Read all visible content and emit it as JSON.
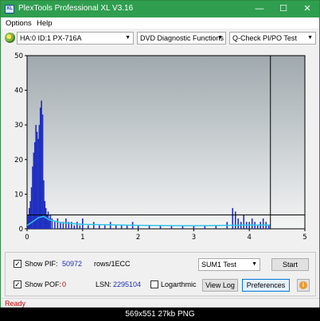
{
  "window": {
    "title": "PlexTools Professional XL V3.16",
    "icon_label": "XL",
    "minimize": "—",
    "maximize": "☐",
    "close": "✕"
  },
  "menu": {
    "items": [
      "Options",
      "Help"
    ]
  },
  "toolbar": {
    "drive": "HA:0 ID:1  PX-716A",
    "function": "DVD Diagnostic Functions",
    "test": "Q-Check PI/PO Test"
  },
  "chart_data": {
    "type": "bar",
    "x_ticks": [
      "0",
      "1",
      "2",
      "3",
      "4",
      "5"
    ],
    "y_ticks": [
      "0",
      "10",
      "20",
      "30",
      "40",
      "50"
    ],
    "xlim": [
      0,
      5
    ],
    "ylim": [
      0,
      50
    ],
    "threshold_value": 4,
    "end_marker_x": 4.38,
    "colors": {
      "pi_bars": "#1f2fc0",
      "pi_avg": "#2ec4e8",
      "threshold": "#000000",
      "end_marker": "#000000"
    },
    "series": [
      {
        "values_x": [
          0.02,
          0.04,
          0.06,
          0.08,
          0.1,
          0.12,
          0.14,
          0.16,
          0.18,
          0.2,
          0.22,
          0.24,
          0.26,
          0.28,
          0.3,
          0.32,
          0.34,
          0.36,
          0.38,
          0.4,
          0.42,
          0.45,
          0.5,
          0.55,
          0.6,
          0.65,
          0.7,
          0.75,
          0.8,
          0.85,
          0.9,
          0.95,
          1.0,
          1.1,
          1.2,
          1.3,
          1.4,
          1.5,
          1.6,
          1.7,
          1.8,
          1.9,
          2.0,
          2.2,
          2.4,
          2.6,
          2.8,
          3.0,
          3.2,
          3.4,
          3.6,
          3.7,
          3.75,
          3.8,
          3.85,
          3.9,
          3.95,
          4.0,
          4.05,
          4.1,
          4.15,
          4.2,
          4.25,
          4.3,
          4.35
        ],
        "values_y": [
          4,
          6,
          8,
          12,
          18,
          22,
          25,
          30,
          28,
          26,
          30,
          35,
          37,
          33,
          14,
          8,
          6,
          4,
          5,
          3,
          4,
          3,
          2,
          3,
          2,
          2,
          3,
          2,
          2,
          1,
          2,
          1,
          3,
          1,
          2,
          1,
          1,
          2,
          1,
          1,
          1,
          2,
          1,
          1,
          1,
          1,
          1,
          1,
          1,
          1,
          2,
          6,
          5,
          3,
          2,
          4,
          2,
          2,
          3,
          2,
          1,
          2,
          3,
          2,
          1
        ]
      },
      {
        "avg_x": [
          0.0,
          0.1,
          0.2,
          0.3,
          0.4,
          0.6,
          1.0,
          2.0,
          3.0,
          4.0,
          4.38
        ],
        "avg_y": [
          1.0,
          2.0,
          3.2,
          3.6,
          2.6,
          1.8,
          1.3,
          1.0,
          0.9,
          1.1,
          1.1
        ]
      }
    ]
  },
  "controls": {
    "show_pif_label": "Show PIF:",
    "show_pif_checked": "✓",
    "pif_value": "50972",
    "pif_unit": "rows/1ECC",
    "show_pof_label": "Show POF:",
    "show_pof_checked": "✓",
    "pof_value": "0",
    "lsn_label": "LSN:",
    "lsn_value": "2295104",
    "logarithmic_label": "Logarthmic",
    "sum_select": "SUM1 Test",
    "start_label": "Start",
    "view_log_label": "View Log",
    "preferences_label": "Preferences",
    "info_label": "i"
  },
  "status": {
    "text": "Ready"
  },
  "caption": {
    "text": "569x551  27kb  PNG"
  }
}
